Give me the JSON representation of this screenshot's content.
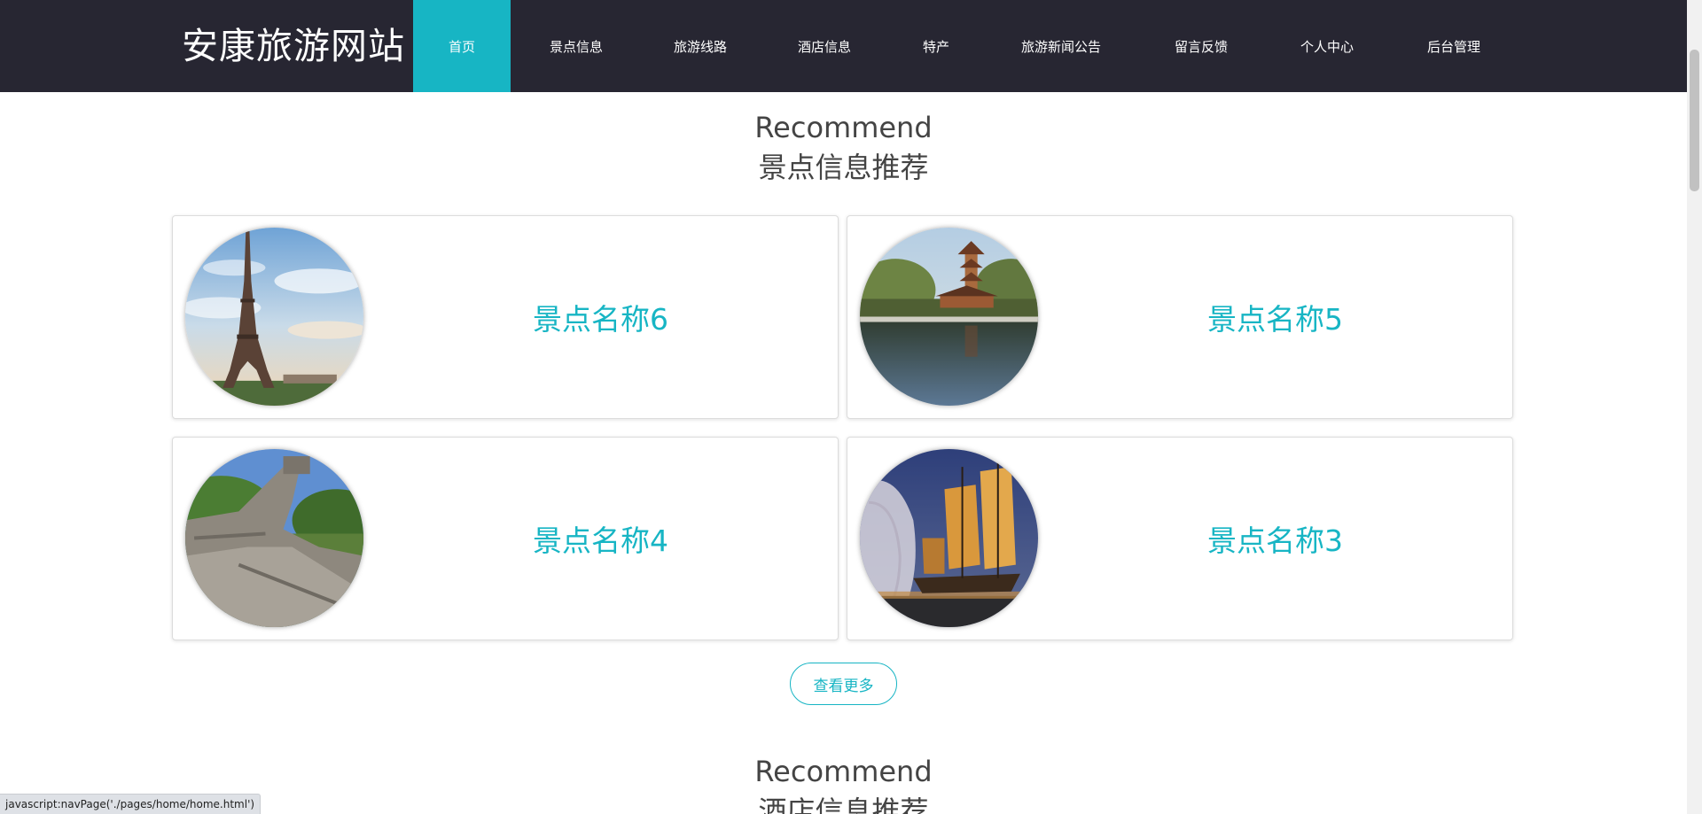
{
  "site": {
    "title": "安康旅游网站"
  },
  "nav": {
    "items": [
      {
        "label": "首页",
        "active": true
      },
      {
        "label": "景点信息",
        "active": false
      },
      {
        "label": "旅游线路",
        "active": false
      },
      {
        "label": "酒店信息",
        "active": false
      },
      {
        "label": "特产",
        "active": false
      },
      {
        "label": "旅游新闻公告",
        "active": false
      },
      {
        "label": "留言反馈",
        "active": false
      },
      {
        "label": "个人中心",
        "active": false
      },
      {
        "label": "后台管理",
        "active": false
      }
    ]
  },
  "attractions": {
    "heading_en": "Recommend",
    "heading_zh": "景点信息推荐",
    "cards": [
      {
        "name": "景点名称6",
        "image": "eiffel-tower-photo"
      },
      {
        "name": "景点名称5",
        "image": "pagoda-lake-photo"
      },
      {
        "name": "景点名称4",
        "image": "great-wall-photo"
      },
      {
        "name": "景点名称3",
        "image": "junk-boat-photo"
      }
    ],
    "more_label": "查看更多"
  },
  "hotels": {
    "heading_en": "Recommend",
    "heading_zh": "酒店信息推荐"
  },
  "status_bar": {
    "url": "javascript:navPage('./pages/home/home.html')"
  },
  "colors": {
    "nav_bg": "#272632",
    "accent": "#17b5c4",
    "text": "#444444"
  }
}
